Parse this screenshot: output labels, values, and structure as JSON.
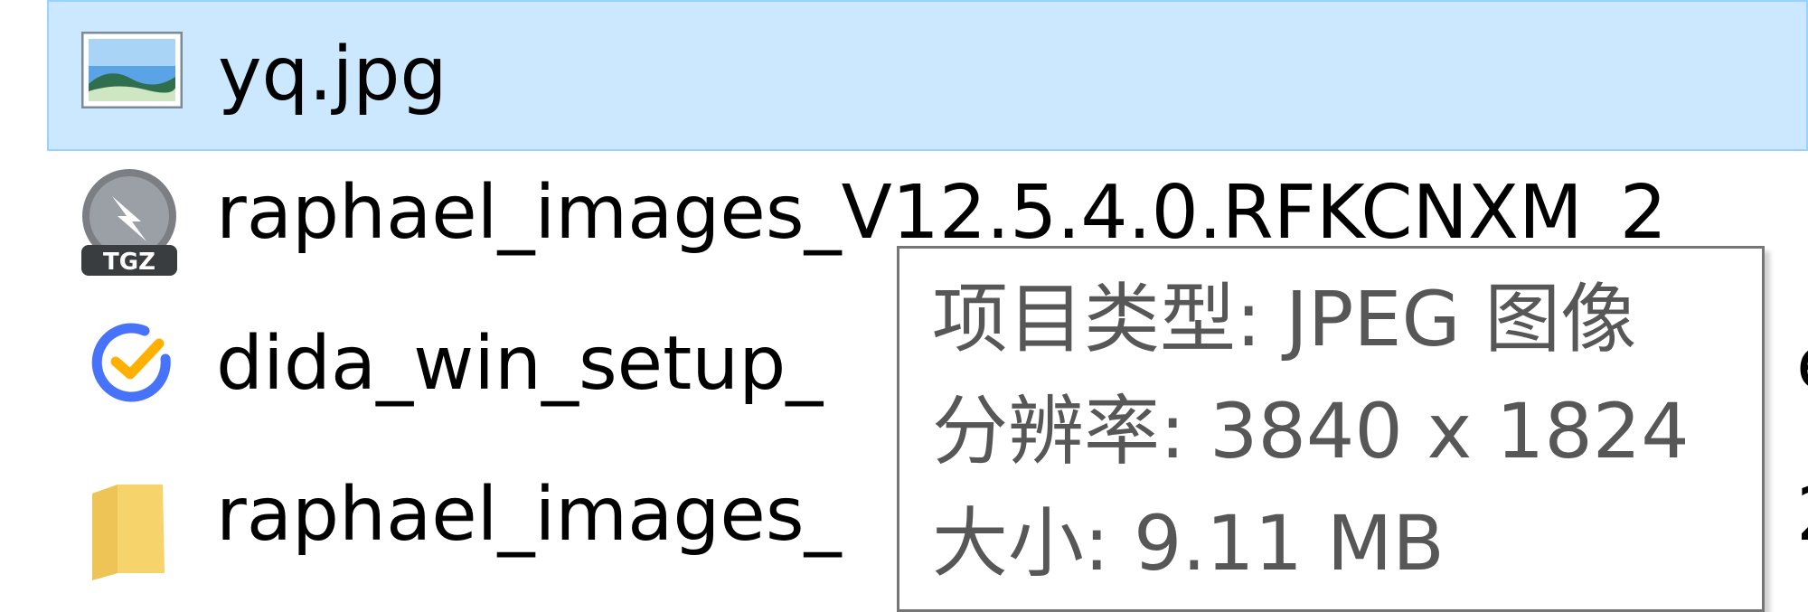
{
  "file_list": {
    "items": [
      {
        "name": "yq.jpg",
        "icon": "image-file-icon",
        "selected": true
      },
      {
        "name": "raphael_images_V12.5.4.0.RFKCNXM_2",
        "icon": "tgz-archive-icon",
        "selected": false
      },
      {
        "name": "dida_win_setup_",
        "icon": "dida-app-icon",
        "selected": false
      },
      {
        "name": "raphael_images_",
        "icon": "folder-icon",
        "selected": false
      }
    ],
    "partial_text_behind_tooltip": {
      "row3_right": "e",
      "row4_right": "2"
    }
  },
  "tooltip": {
    "item_type": "项目类型: JPEG 图像",
    "resolution": "分辨率: 3840 x 1824",
    "size": "大小: 9.11 MB"
  },
  "colors": {
    "selection_bg": "#cce8ff",
    "selection_border": "#99d1ff",
    "tooltip_border": "#767676",
    "tooltip_text": "#575757",
    "dida_blue": "#4772fa",
    "dida_orange": "#ffb000",
    "folder_yellow": "#f6d36b"
  }
}
